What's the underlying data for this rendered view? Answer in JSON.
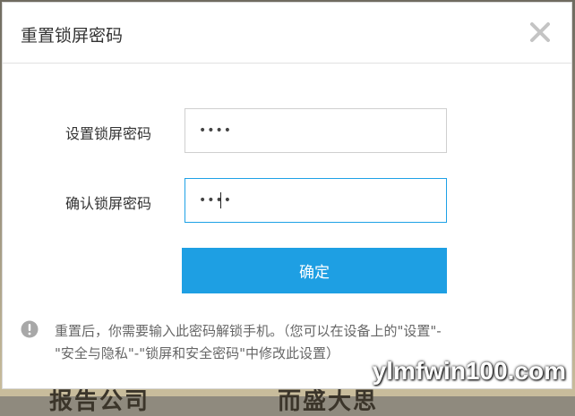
{
  "dialog": {
    "title": "重置锁屏密码"
  },
  "form": {
    "set_label": "设置锁屏密码",
    "set_value": "••••",
    "confirm_label": "确认锁屏密码",
    "confirm_value": "••••",
    "submit_label": "确定"
  },
  "note": {
    "line1": "重置后，你需要输入此密码解锁手机。（您可以在设备上的\"设置\"-",
    "line2": "\"安全与隐私\"-\"锁屏和安全密码\"中修改此设置）"
  },
  "watermark": "ylmfwin100.com",
  "background_text": {
    "left": "报告公司",
    "right": "而盛大思"
  },
  "colors": {
    "accent": "#1e9fe3",
    "focus_border": "#1ea1e6"
  }
}
